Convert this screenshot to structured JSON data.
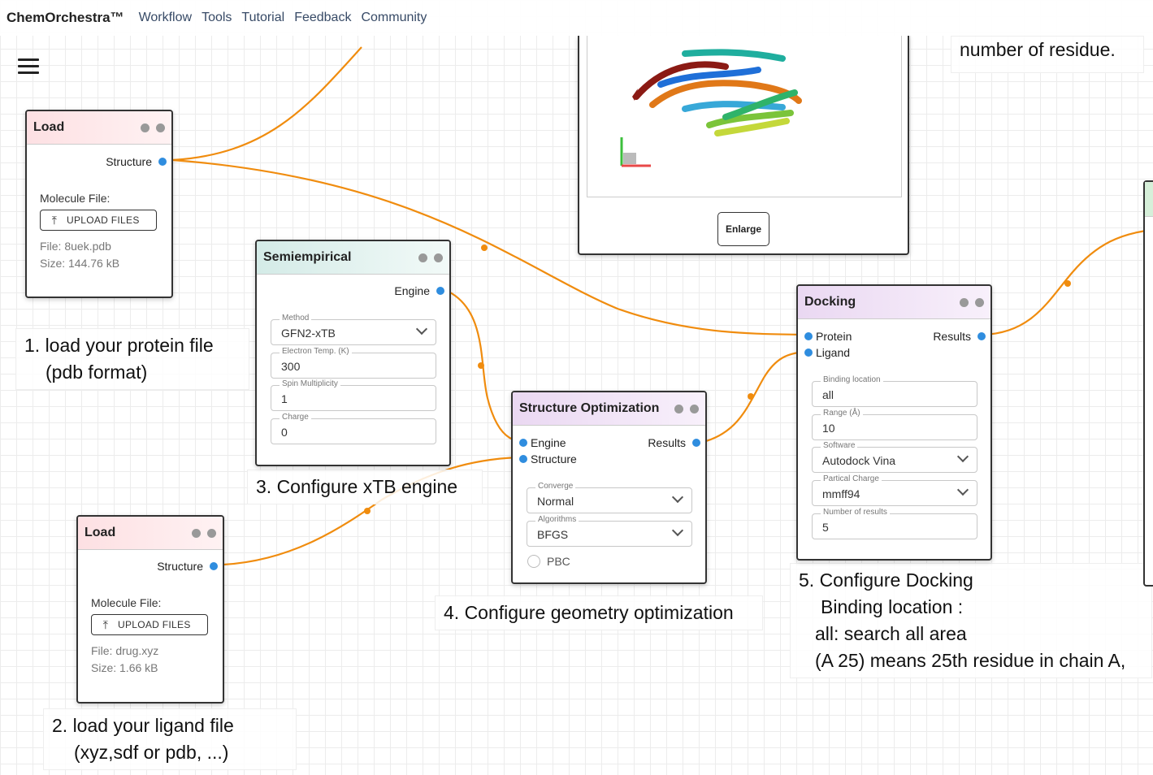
{
  "app": {
    "brand": "ChemOrchestra™",
    "nav": [
      "Workflow",
      "Tools",
      "Tutorial",
      "Feedback",
      "Community"
    ]
  },
  "load_protein": {
    "title": "Load",
    "output": "Structure",
    "file_label": "Molecule File:",
    "upload_label": "UPLOAD FILES",
    "file_name": "File: 8uek.pdb",
    "file_size": "Size: 144.76 kB"
  },
  "load_ligand": {
    "title": "Load",
    "output": "Structure",
    "file_label": "Molecule File:",
    "upload_label": "UPLOAD FILES",
    "file_name": "File: drug.xyz",
    "file_size": "Size: 1.66 kB"
  },
  "semiempirical": {
    "title": "Semiempirical",
    "output": "Engine",
    "fields": [
      {
        "label": "Method",
        "value": "GFN2-xTB",
        "select": true
      },
      {
        "label": "Electron Temp. (K)",
        "value": "300",
        "select": false
      },
      {
        "label": "Spin Multiplicity",
        "value": "1",
        "select": false
      },
      {
        "label": "Charge",
        "value": "0",
        "select": false
      }
    ]
  },
  "optimization": {
    "title": "Structure Optimization",
    "inputs": [
      "Engine",
      "Structure"
    ],
    "output": "Results",
    "fields": [
      {
        "label": "Converge",
        "value": "Normal",
        "select": true
      },
      {
        "label": "Algorithms",
        "value": "BFGS",
        "select": true
      }
    ],
    "pbc_label": "PBC"
  },
  "docking": {
    "title": "Docking",
    "inputs": [
      "Protein",
      "Ligand"
    ],
    "output": "Results",
    "fields": [
      {
        "label": "Binding location",
        "value": "all",
        "select": false
      },
      {
        "label": "Range (Å)",
        "value": "10",
        "select": false
      },
      {
        "label": "Software",
        "value": "Autodock Vina",
        "select": true
      },
      {
        "label": "Partical Charge",
        "value": "mmff94",
        "select": true
      },
      {
        "label": "Number of results",
        "value": "5",
        "select": false
      }
    ]
  },
  "viewer": {
    "enlarge_label": "Enlarge"
  },
  "annotations": {
    "top_right": "number of residue.",
    "step1_line1": "1. load your protein file",
    "step1_line2": "(pdb format)",
    "step2_line1": "2. load your ligand file",
    "step2_line2": "(xyz,sdf or pdb, ...)",
    "step3": "3. Configure xTB engine",
    "step4": "4. Configure geometry optimization",
    "step5_line1": "5. Configure Docking",
    "step5_line2": "Binding location :",
    "step5_line3": "all: search all area",
    "step5_line4": "(A 25) means 25th residue in chain A,"
  },
  "colors": {
    "wire": "#f08c0e",
    "port": "#2f8ddf"
  }
}
